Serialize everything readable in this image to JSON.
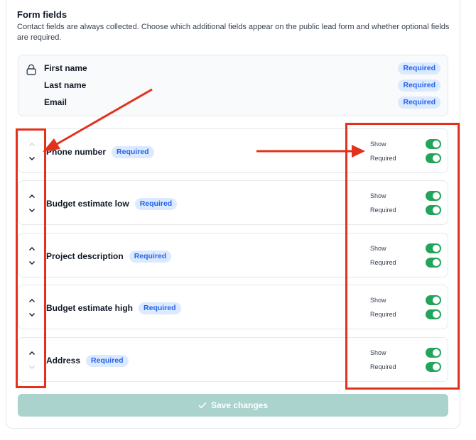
{
  "section": {
    "title": "Form fields",
    "description": "Contact fields are always collected. Choose which additional fields appear on the public lead form and whether optional fields are required."
  },
  "fixed_fields": [
    {
      "label": "First name",
      "badge": "Required"
    },
    {
      "label": "Last name",
      "badge": "Required"
    },
    {
      "label": "Email",
      "badge": "Required"
    }
  ],
  "fields": [
    {
      "name": "Phone number",
      "badge": "Required",
      "show_label": "Show",
      "required_label": "Required",
      "show": true,
      "required": true,
      "up_enabled": false,
      "down_enabled": true
    },
    {
      "name": "Budget estimate low",
      "badge": "Required",
      "show_label": "Show",
      "required_label": "Required",
      "show": true,
      "required": true,
      "up_enabled": true,
      "down_enabled": true
    },
    {
      "name": "Project description",
      "badge": "Required",
      "show_label": "Show",
      "required_label": "Required",
      "show": true,
      "required": true,
      "up_enabled": true,
      "down_enabled": true
    },
    {
      "name": "Budget estimate high",
      "badge": "Required",
      "show_label": "Show",
      "required_label": "Required",
      "show": true,
      "required": true,
      "up_enabled": true,
      "down_enabled": true
    },
    {
      "name": "Address",
      "badge": "Required",
      "show_label": "Show",
      "required_label": "Required",
      "show": true,
      "required": true,
      "up_enabled": true,
      "down_enabled": false
    }
  ],
  "save_button": {
    "label": "Save changes",
    "icon": "check-icon"
  },
  "colors": {
    "toggle_on": "#22a55b",
    "badge_bg": "#dbeafe",
    "badge_text": "#2563eb",
    "save_bg": "#aad3cd",
    "annotation": "#e4311c"
  }
}
